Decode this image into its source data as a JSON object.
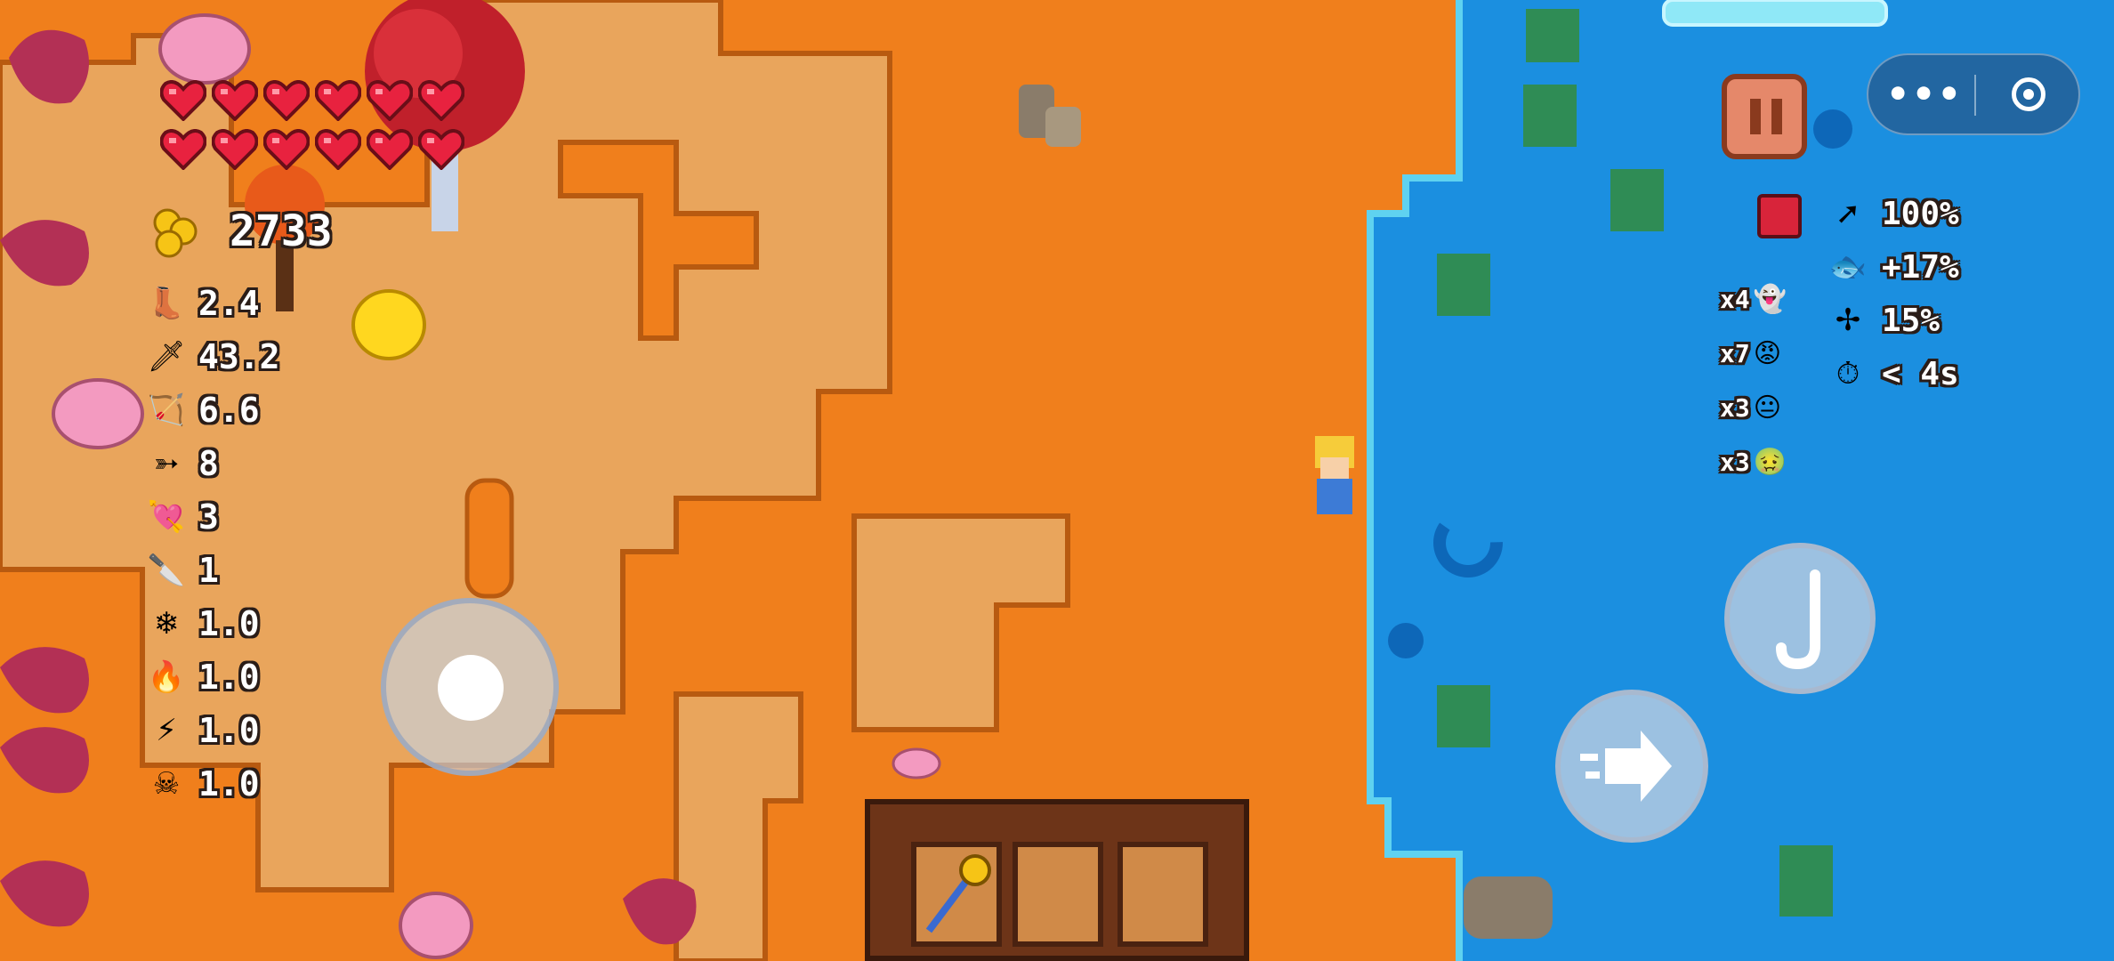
{
  "hud": {
    "coins": "2733",
    "hearts_row1": 6,
    "hearts_row2": 6
  },
  "stats": [
    {
      "icon": "boot-icon",
      "value": "2.4"
    },
    {
      "icon": "sword-icon",
      "value": "43.2"
    },
    {
      "icon": "bow-icon",
      "value": "6.6"
    },
    {
      "icon": "arrows-icon",
      "value": "8"
    },
    {
      "icon": "heart-arrow-icon",
      "value": "3"
    },
    {
      "icon": "dagger-icon",
      "value": "1"
    },
    {
      "icon": "ice-crystal-icon",
      "value": "1.0"
    },
    {
      "icon": "fire-icon",
      "value": "1.0"
    },
    {
      "icon": "lightning-icon",
      "value": "1.0"
    },
    {
      "icon": "poison-skull-icon",
      "value": "1.0"
    }
  ],
  "buffs": [
    {
      "icon": "arrow-icon",
      "value": "100%"
    },
    {
      "icon": "fish-icon",
      "value": "+17%"
    },
    {
      "icon": "crossbow-icon",
      "value": "15%"
    },
    {
      "icon": "stopwatch-icon",
      "value": "< 4s"
    }
  ],
  "enemy_counts": [
    {
      "icon": "ghost-face-icon",
      "count": "x4"
    },
    {
      "icon": "red-face-icon",
      "count": "x7"
    },
    {
      "icon": "yellow-face-icon",
      "count": "x3"
    },
    {
      "icon": "green-face-icon",
      "count": "x3"
    }
  ],
  "colors": {
    "ground": "#f07f1c",
    "path": "#e9a55c",
    "water": "#1b8fe0",
    "heart": "#e8223f",
    "pause": "#e5886a"
  },
  "inventory": {
    "slots": [
      "golden-staff-icon",
      "",
      ""
    ]
  }
}
